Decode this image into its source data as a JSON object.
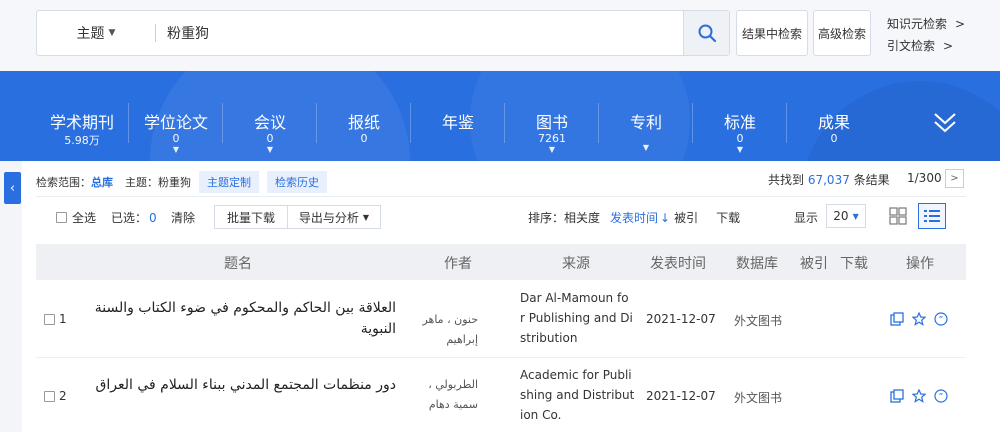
{
  "search": {
    "field_label": "主题",
    "query": "粉重狗",
    "within_results_label": "结果中检索",
    "advanced_label": "高级检索",
    "link_knowledge": "知识元检索",
    "link_citation": "引文检索",
    "link_arrow": ">"
  },
  "databases": [
    {
      "label": "学术期刊",
      "count": "5.98万",
      "has_dropdown": true
    },
    {
      "label": "学位论文",
      "count": "0",
      "has_dropdown": true
    },
    {
      "label": "会议",
      "count": "0",
      "has_dropdown": true
    },
    {
      "label": "报纸",
      "count": "0",
      "has_dropdown": false
    },
    {
      "label": "年鉴",
      "count": "",
      "has_dropdown": false
    },
    {
      "label": "图书",
      "count": "7261",
      "has_dropdown": true
    },
    {
      "label": "专利",
      "count": "",
      "has_dropdown": true
    },
    {
      "label": "标准",
      "count": "0",
      "has_dropdown": true
    },
    {
      "label": "成果",
      "count": "0",
      "has_dropdown": false
    }
  ],
  "scope": {
    "label": "检索范围：",
    "value": "总库",
    "topic_label": "主题：",
    "topic_value": "粉重狗",
    "btn_custom": "主题定制",
    "btn_history": "检索历史"
  },
  "results": {
    "found_prefix": "共找到",
    "found_count": "67,037",
    "found_suffix": "条结果",
    "page": "1/300",
    "next": ">"
  },
  "toolbar": {
    "select_all": "全选",
    "selected_label": "已选：",
    "selected_count": "0",
    "clear": "清除",
    "batch_download": "批量下载",
    "export_analysis": "导出与分析",
    "sort_label": "排序：",
    "sort_relevance": "相关度",
    "sort_date": "发表时间",
    "sort_cited": "被引",
    "sort_download": "下载",
    "show_label": "显示",
    "show_value": "20"
  },
  "table": {
    "headers": {
      "title": "题名",
      "author": "作者",
      "source": "来源",
      "date": "发表时间",
      "database": "数据库",
      "cited": "被引",
      "download": "下载",
      "ops": "操作"
    },
    "rows": [
      {
        "index": "1",
        "title": "العلاقة بين الحاكم والمحكوم في ضوء الكتاب والسنة النبوية",
        "author": "حنون ، ماهر إبراهيم",
        "source_lines": [
          "Dar Al-Mamoun fo",
          "r Publishing and Di",
          "stribution"
        ],
        "date": "2021-12-07",
        "database": "外文图书"
      },
      {
        "index": "2",
        "title": "دور منظمات المجتمع المدني ببناء السلام في العراق",
        "author": "الطربولي ، سمية دهام",
        "source_lines": [
          "Academic for Publi",
          "shing and Distribut",
          "ion Co."
        ],
        "date": "2021-12-07",
        "database": "外文图书"
      }
    ]
  },
  "colors": {
    "accent": "#2a6fe0",
    "band": "#2a6fe0"
  }
}
